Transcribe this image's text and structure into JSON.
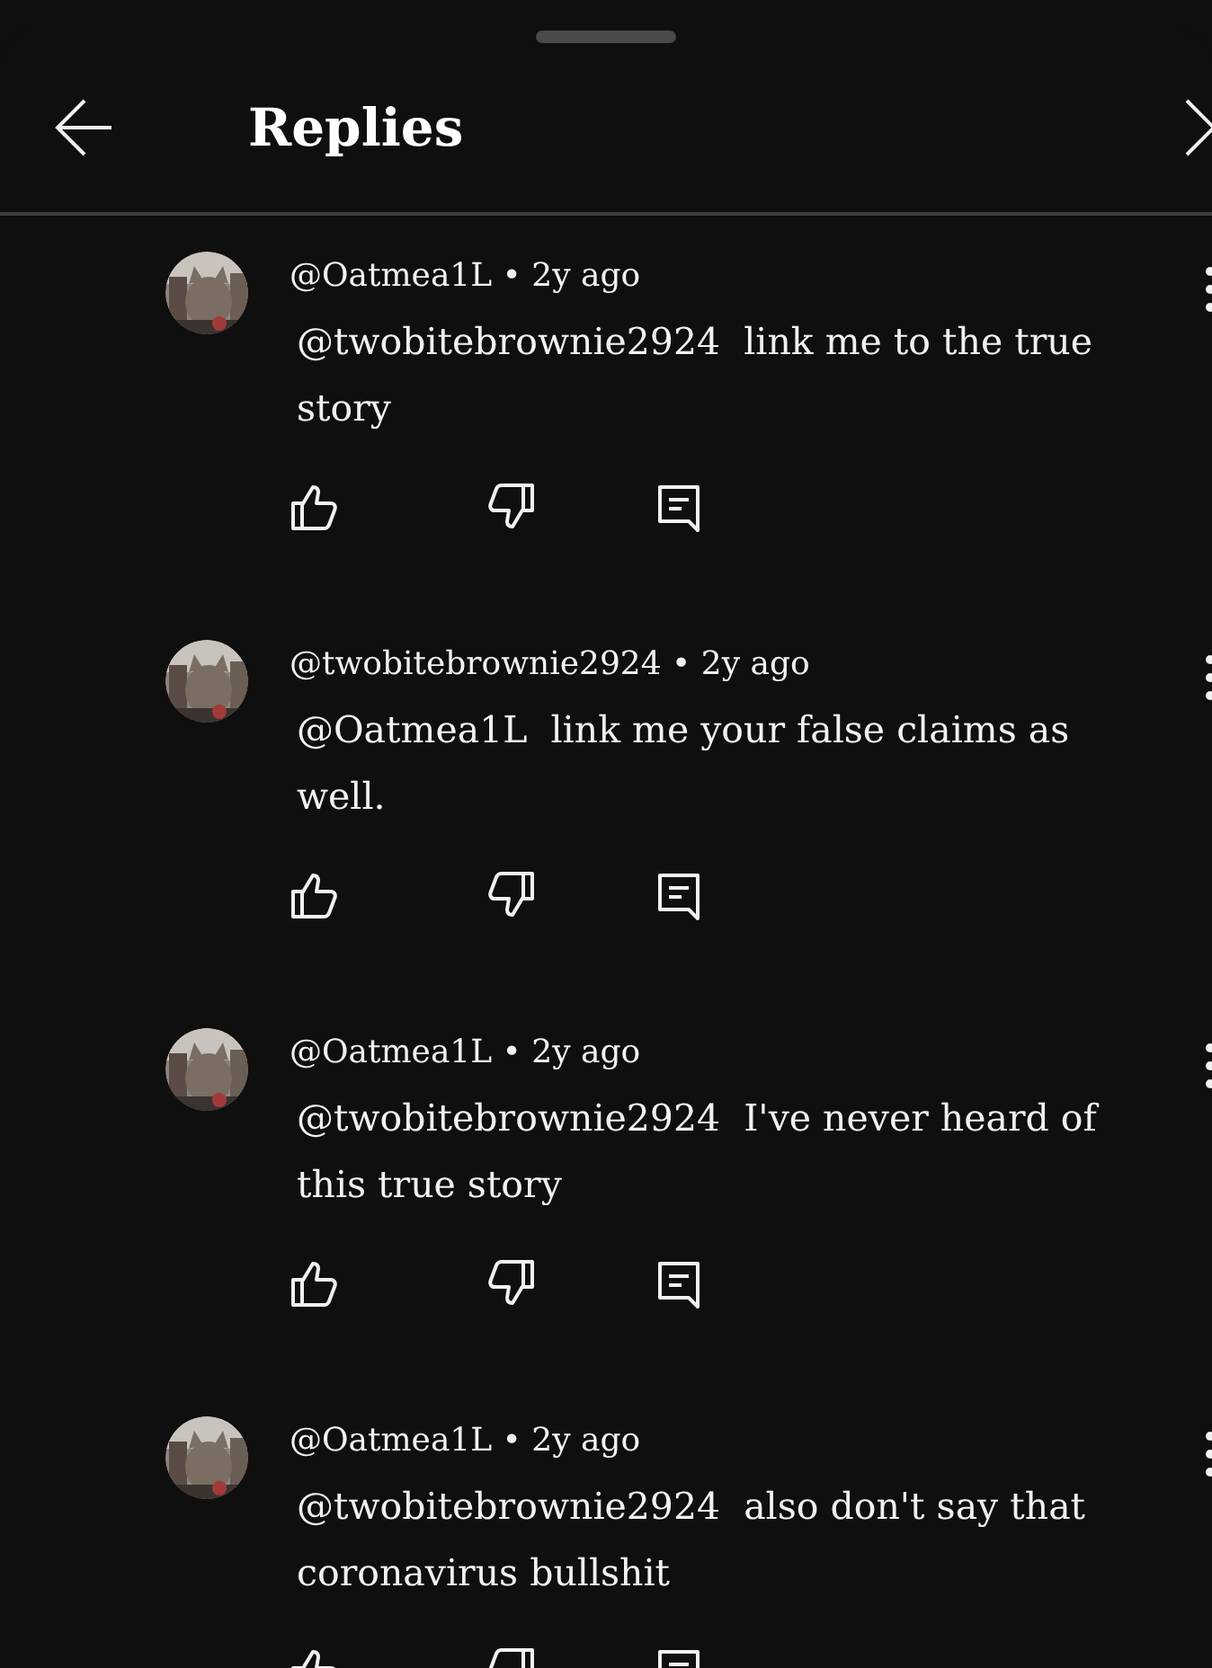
{
  "header": {
    "title": "Replies"
  },
  "comments": [
    {
      "byline": "@Oatmea1L • 2y ago",
      "text": "@twobitebrownie2924  link me to the true story"
    },
    {
      "byline": "@twobitebrownie2924 • 2y ago",
      "text": "@Oatmea1L  link me your false claims as well."
    },
    {
      "byline": "@Oatmea1L • 2y ago",
      "text": "@twobitebrownie2924  I've never heard of this true story"
    },
    {
      "byline": "@Oatmea1L • 2y ago",
      "text": "@twobitebrownie2924  also don't say that coronavirus bullshit"
    }
  ]
}
